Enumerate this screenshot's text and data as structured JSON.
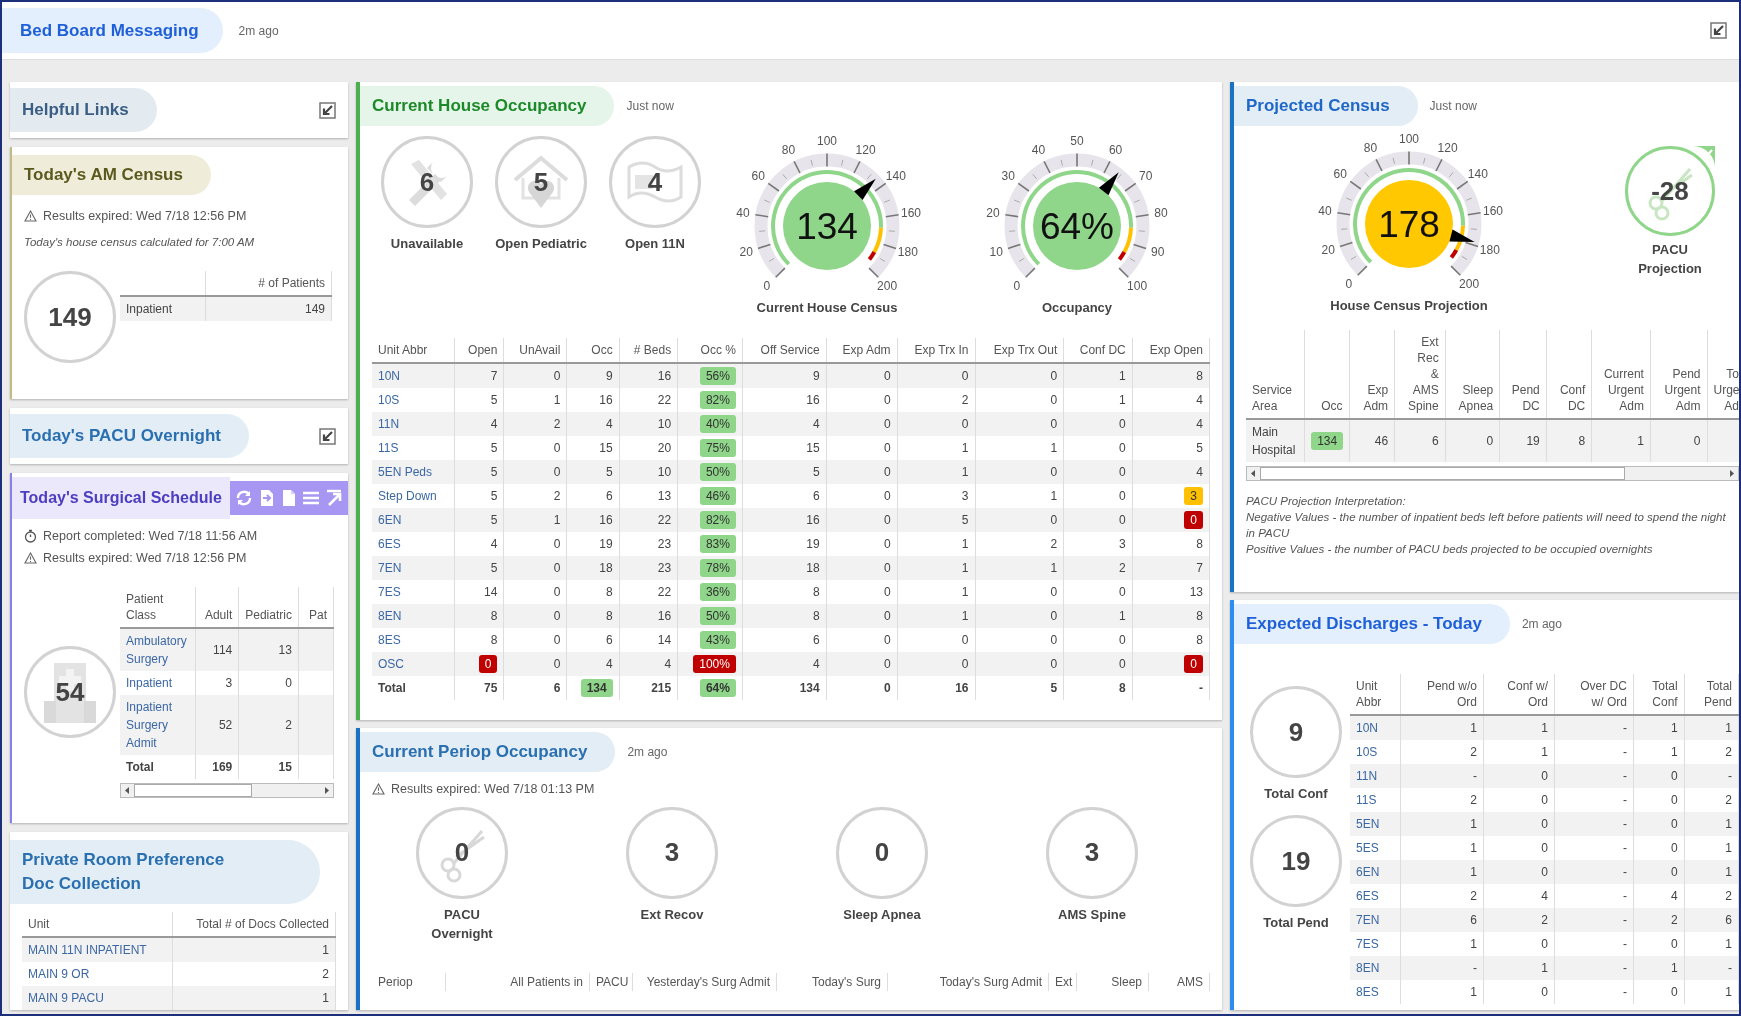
{
  "header": {
    "title": "Bed Board Messaging",
    "updated": "2m ago"
  },
  "helpful_links": {
    "title": "Helpful Links"
  },
  "am_census": {
    "title": "Today's AM Census",
    "notice": "Results expired: Wed 7/18 12:56 PM",
    "note": "Today's house census calculated for 7:00 AM",
    "total": "149",
    "columns": [
      "",
      "# of Patients"
    ],
    "rows": [
      [
        "Inpatient",
        "149"
      ]
    ]
  },
  "pacu_overnight": {
    "title": "Today's PACU Overnight"
  },
  "surgical_schedule": {
    "title": "Today's Surgical Schedule",
    "report": "Report completed: Wed 7/18 11:56 AM",
    "notice": "Results expired: Wed 7/18 12:56 PM",
    "total": "54",
    "columns": [
      "Patient Class",
      "Adult",
      "Pediatric",
      "Pat"
    ],
    "rows": [
      [
        "Ambulatory Surgery",
        "114",
        "13"
      ],
      [
        "Inpatient",
        "3",
        "0"
      ],
      [
        "Inpatient Surgery Admit",
        "52",
        "2"
      ]
    ],
    "total_row": [
      "Total",
      "169",
      "15"
    ]
  },
  "private_rooms": {
    "title": "Private Room Preference Doc Collection",
    "columns": [
      "Unit",
      "Total # of Docs Collected"
    ],
    "rows": [
      [
        "MAIN 11N INPATIENT",
        "1"
      ],
      [
        "MAIN 9 OR",
        "2"
      ],
      [
        "MAIN 9 PACU",
        "1"
      ]
    ]
  },
  "house_occupancy": {
    "title": "Current House Occupancy",
    "updated": "Just now",
    "stats": [
      {
        "value": "6",
        "label": "Unavailable"
      },
      {
        "value": "5",
        "label": "Open Pediatric"
      },
      {
        "value": "4",
        "label": "Open 11N"
      }
    ],
    "gauges": [
      {
        "label": "Current House Census",
        "value": "134",
        "color": "#8fd68a",
        "ticks": [
          "0",
          "20",
          "40",
          "60",
          "80",
          "100",
          "120",
          "140",
          "160",
          "180",
          "200"
        ]
      },
      {
        "label": "Occupancy",
        "value": "64%",
        "color": "#8fd68a",
        "ticks": [
          "0",
          "10",
          "20",
          "30",
          "40",
          "50",
          "60",
          "70",
          "80",
          "90",
          "100"
        ]
      }
    ],
    "columns": [
      "Unit Abbr",
      "Open",
      "UnAvail",
      "Occ",
      "# Beds",
      "Occ %",
      "Off Service",
      "Exp Adm",
      "Exp Trx In",
      "Exp Trx Out",
      "Conf DC",
      "Exp Open"
    ],
    "rows": [
      [
        "10N",
        "7",
        "0",
        "9",
        "16",
        {
          "text": "56%",
          "color": "#8fd68a"
        },
        "9",
        "0",
        "0",
        "0",
        "1",
        "8"
      ],
      [
        "10S",
        "5",
        "1",
        "16",
        "22",
        {
          "text": "82%",
          "color": "#8fd68a"
        },
        "16",
        "0",
        "2",
        "0",
        "1",
        "4"
      ],
      [
        "11N",
        "4",
        "2",
        "4",
        "10",
        {
          "text": "40%",
          "color": "#8fd68a"
        },
        "4",
        "0",
        "0",
        "0",
        "0",
        "4"
      ],
      [
        "11S",
        "5",
        "0",
        "15",
        "20",
        {
          "text": "75%",
          "color": "#8fd68a"
        },
        "15",
        "0",
        "1",
        "1",
        "0",
        "5"
      ],
      [
        "5EN Peds",
        "5",
        "0",
        "5",
        "10",
        {
          "text": "50%",
          "color": "#8fd68a"
        },
        "5",
        "0",
        "1",
        "0",
        "0",
        "4"
      ],
      [
        "Step Down",
        "5",
        "2",
        "6",
        "13",
        {
          "text": "46%",
          "color": "#8fd68a"
        },
        "6",
        "0",
        "3",
        "1",
        "0",
        {
          "text": "3",
          "color": "#ffc000"
        }
      ],
      [
        "6EN",
        "5",
        "1",
        "16",
        "22",
        {
          "text": "82%",
          "color": "#8fd68a"
        },
        "16",
        "0",
        "5",
        "0",
        "0",
        {
          "text": "0",
          "color": "#c00000"
        }
      ],
      [
        "6ES",
        "4",
        "0",
        "19",
        "23",
        {
          "text": "83%",
          "color": "#8fd68a"
        },
        "19",
        "0",
        "1",
        "2",
        "3",
        "8"
      ],
      [
        "7EN",
        "5",
        "0",
        "18",
        "23",
        {
          "text": "78%",
          "color": "#8fd68a"
        },
        "18",
        "0",
        "1",
        "1",
        "2",
        "7"
      ],
      [
        "7ES",
        "14",
        "0",
        "8",
        "22",
        {
          "text": "36%",
          "color": "#8fd68a"
        },
        "8",
        "0",
        "1",
        "0",
        "0",
        "13"
      ],
      [
        "8EN",
        "8",
        "0",
        "8",
        "16",
        {
          "text": "50%",
          "color": "#8fd68a"
        },
        "8",
        "0",
        "1",
        "0",
        "1",
        "8"
      ],
      [
        "8ES",
        "8",
        "0",
        "6",
        "14",
        {
          "text": "43%",
          "color": "#8fd68a"
        },
        "6",
        "0",
        "0",
        "0",
        "0",
        "8"
      ],
      [
        "OSC",
        {
          "text": "0",
          "color": "#c00000"
        },
        "0",
        "4",
        "4",
        {
          "text": "100%",
          "color": "#c00000"
        },
        "4",
        "0",
        "0",
        "0",
        "0",
        {
          "text": "0",
          "color": "#c00000"
        }
      ]
    ],
    "total_row": [
      "Total",
      "75",
      "6",
      {
        "text": "134",
        "color": "#8fd68a"
      },
      "215",
      {
        "text": "64%",
        "color": "#8fd68a"
      },
      "134",
      "0",
      "16",
      "5",
      "8",
      "-"
    ]
  },
  "periop": {
    "title": "Current Periop Occupancy",
    "updated": "2m ago",
    "notice": "Results expired: Wed 7/18 01:13 PM",
    "stats": [
      {
        "value": "0",
        "label": "PACU Overnight"
      },
      {
        "value": "3",
        "label": "Ext Recov"
      },
      {
        "value": "0",
        "label": "Sleep Apnea"
      },
      {
        "value": "3",
        "label": "AMS Spine"
      }
    ],
    "columns": [
      "Periop",
      "All Patients in",
      "PACU",
      "Yesterday's Surg Admit",
      "Today's Surg",
      "Today's Surg Admit",
      "Ext",
      "Sleep",
      "AMS"
    ]
  },
  "projected": {
    "title": "Projected Census",
    "updated": "Just now",
    "gauge": {
      "label": "House Census Projection",
      "value": "178",
      "color": "#ffc800",
      "ticks": [
        "0",
        "20",
        "40",
        "60",
        "80",
        "100",
        "120",
        "140",
        "160",
        "180",
        "200"
      ]
    },
    "pacu": {
      "value": "-28",
      "label": "PACU Projection"
    },
    "columns": [
      "Service\nArea",
      "Occ",
      "Exp\nAdm",
      "Ext\nRec\n&\nAMS\nSpine",
      "Sleep\nApnea",
      "Pend\nDC",
      "Conf\nDC",
      "Current\nUrgent\nAdm",
      "Pend\nUrgent\nAdm",
      "To\nUrge\nAd"
    ],
    "rows": [
      [
        "Main Hospital",
        {
          "text": "134",
          "color": "#8fd68a"
        },
        "46",
        "6",
        "0",
        "19",
        "8",
        "1",
        "0"
      ]
    ],
    "notes": [
      "PACU Projection Interpretation:",
      "Negative Values - the number of inpatient beds left before patients will need to spend the night in PACU",
      "Positive Values - the number of PACU beds projected to be occupied overnights"
    ]
  },
  "discharges": {
    "title": "Expected Discharges - Today",
    "updated": "2m ago",
    "stats": [
      {
        "value": "9",
        "label": "Total Conf"
      },
      {
        "value": "19",
        "label": "Total Pend"
      }
    ],
    "columns": [
      "Unit\nAbbr",
      "Pend w/o\nOrd",
      "Conf w/\nOrd",
      "Over DC\nw/ Ord",
      "Total\nConf",
      "Total\nPend"
    ],
    "rows": [
      [
        "10N",
        "1",
        "1",
        "-",
        "1",
        "1"
      ],
      [
        "10S",
        "2",
        "1",
        "-",
        "1",
        "2"
      ],
      [
        "11N",
        "-",
        "0",
        "-",
        "0",
        "-"
      ],
      [
        "11S",
        "2",
        "0",
        "-",
        "0",
        "2"
      ],
      [
        "5EN",
        "1",
        "0",
        "-",
        "0",
        "1"
      ],
      [
        "5ES",
        "1",
        "0",
        "-",
        "0",
        "1"
      ],
      [
        "6EN",
        "1",
        "0",
        "-",
        "0",
        "1"
      ],
      [
        "6ES",
        "2",
        "4",
        "-",
        "4",
        "2"
      ],
      [
        "7EN",
        "6",
        "2",
        "-",
        "2",
        "6"
      ],
      [
        "7ES",
        "1",
        "0",
        "-",
        "0",
        "1"
      ],
      [
        "8EN",
        "-",
        "1",
        "-",
        "1",
        "-"
      ],
      [
        "8ES",
        "1",
        "0",
        "-",
        "0",
        "1"
      ]
    ]
  }
}
